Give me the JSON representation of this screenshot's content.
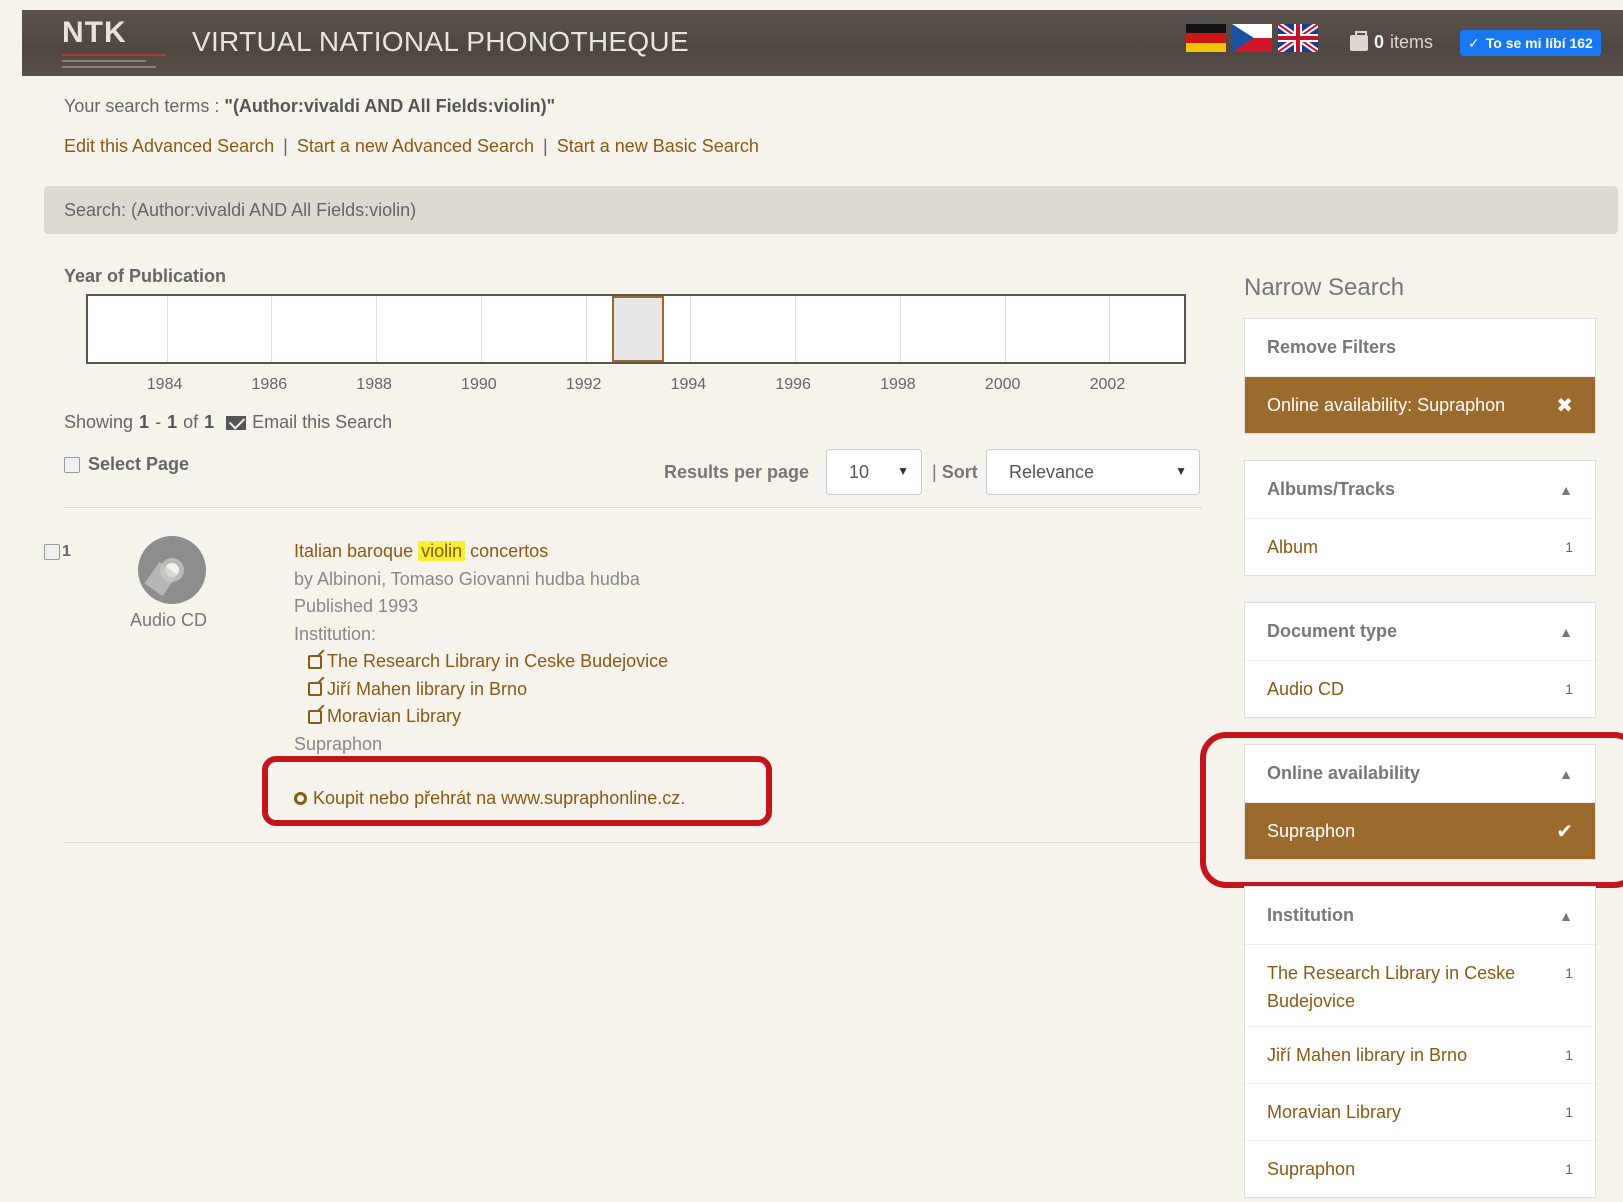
{
  "header": {
    "logo": "NTK",
    "title": "VIRTUAL NATIONAL PHONOTHEQUE",
    "flags": [
      "german-flag",
      "czech-flag",
      "uk-flag"
    ],
    "cart_count": "0",
    "cart_label": "items",
    "like_label": "To se mi líbí 162"
  },
  "search_terms": {
    "prefix": "Your search terms : ",
    "value": "\"(Author:vivaldi AND All Fields:violin)\""
  },
  "links": {
    "edit": "Edit this Advanced Search",
    "new_advanced": "Start a new Advanced Search",
    "new_basic": "Start a new Basic Search",
    "sep": "|"
  },
  "search_bar": "Search: (Author:vivaldi AND All Fields:violin)",
  "histogram": {
    "label": "Year of Publication",
    "years": [
      "1984",
      "1986",
      "1988",
      "1990",
      "1992",
      "1994",
      "1996",
      "1998",
      "2000",
      "2002"
    ],
    "selected_year": 1993
  },
  "showing": {
    "prefix": "Showing",
    "from": "1",
    "dash": "-",
    "to": "1",
    "of_label": "of",
    "total": "1",
    "email": "Email this Search"
  },
  "select_page": "Select Page",
  "results_per_page": {
    "label": "Results per page",
    "value": "10"
  },
  "sort": {
    "sep": "|",
    "label": "Sort",
    "value": "Relevance"
  },
  "result": {
    "index": "1",
    "format": "Audio CD",
    "title_pre": "Italian baroque",
    "title_hl": "violin",
    "title_post": "concertos",
    "by": "by Albinoni, Tomaso Giovanni hudba hudba",
    "published": "Published 1993",
    "institution_label": "Institution:",
    "institutions": [
      "The Research Library in Ceske Budejovice",
      "Jiří Mahen library in Brno",
      "Moravian Library"
    ],
    "publisher": "Supraphon",
    "buy": "Koupit nebo přehrát na www.supraphonline.cz."
  },
  "sidebar": {
    "title": "Narrow Search",
    "remove_filters": "Remove Filters",
    "active_filter": "Online availability: Supraphon",
    "albums": {
      "head": "Albums/Tracks",
      "items": [
        {
          "label": "Album",
          "count": "1"
        }
      ]
    },
    "doctype": {
      "head": "Document type",
      "items": [
        {
          "label": "Audio CD",
          "count": "1"
        }
      ]
    },
    "online": {
      "head": "Online availability",
      "items": [
        {
          "label": "Supraphon"
        }
      ]
    },
    "institution": {
      "head": "Institution",
      "items": [
        {
          "label": "The Research Library in Ceske Budejovice",
          "count": "1"
        },
        {
          "label": "Jiří Mahen library in Brno",
          "count": "1"
        },
        {
          "label": "Moravian Library",
          "count": "1"
        },
        {
          "label": "Supraphon",
          "count": "1"
        }
      ]
    }
  },
  "colors": {
    "accent": "#9a6b2c",
    "link": "#8a5a15",
    "highlight_box": "#c4141c",
    "header_bg": "#4d4641"
  }
}
